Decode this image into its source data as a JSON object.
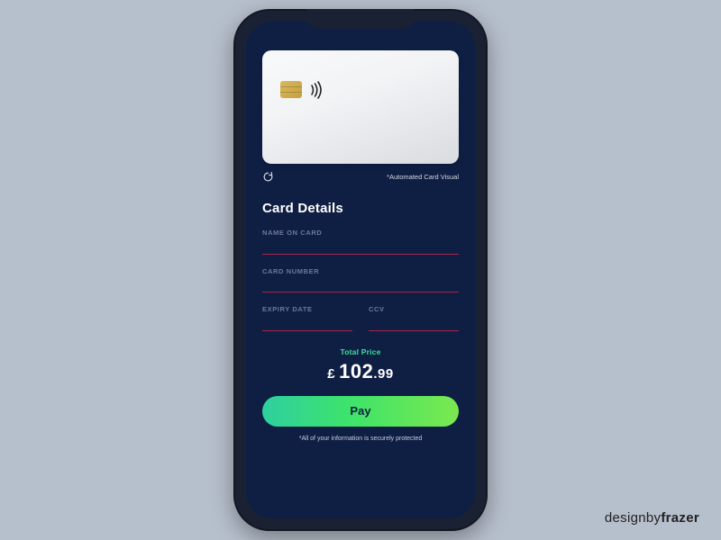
{
  "card_visual_note": "*Automated Card Visual",
  "section_title": "Card Details",
  "fields": {
    "name_label": "NAME ON CARD",
    "name_value": "",
    "number_label": "CARD NUMBER",
    "number_value": "",
    "expiry_label": "EXPIRY DATE",
    "expiry_value": "",
    "ccv_label": "CCV",
    "ccv_value": ""
  },
  "total": {
    "label": "Total Price",
    "currency": "£",
    "whole": "102",
    "cents": ".99"
  },
  "pay_label": "Pay",
  "secure_note": "*All of your information is securely protected",
  "credit_prefix": "designby",
  "credit_bold": "frazer"
}
